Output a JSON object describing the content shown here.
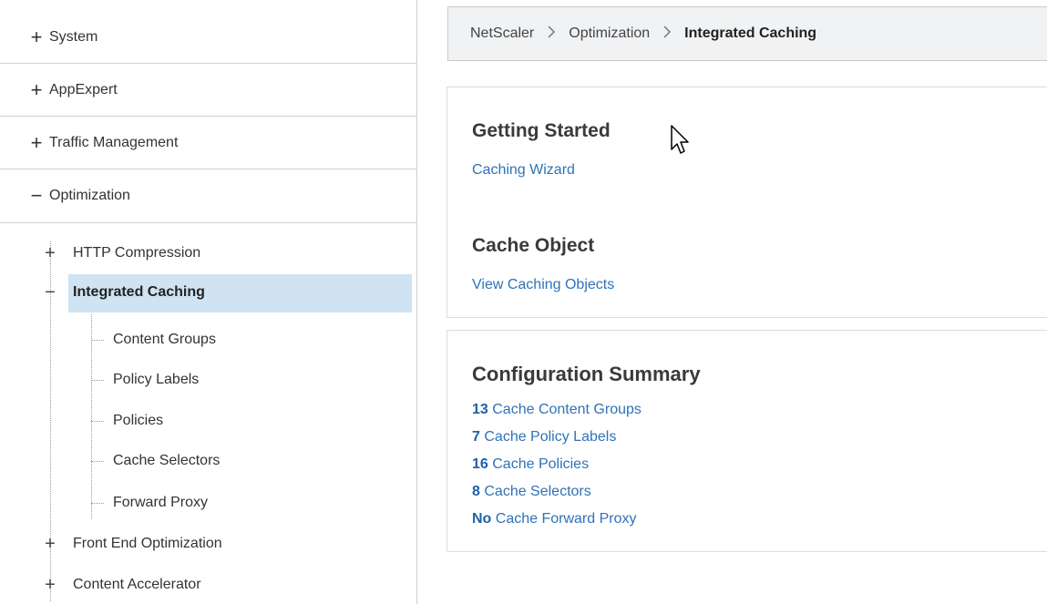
{
  "sidebar": {
    "top_items": [
      {
        "symbol": "+",
        "label": "System"
      },
      {
        "symbol": "+",
        "label": "AppExpert"
      },
      {
        "symbol": "+",
        "label": "Traffic Management"
      },
      {
        "symbol": "−",
        "label": "Optimization"
      }
    ],
    "sub_items": [
      {
        "symbol": "+",
        "label": "HTTP Compression"
      },
      {
        "symbol": "−",
        "label": "Integrated Caching"
      },
      {
        "symbol": "+",
        "label": "Front End Optimization"
      },
      {
        "symbol": "+",
        "label": "Content Accelerator"
      }
    ],
    "leaves": [
      "Content Groups",
      "Policy Labels",
      "Policies",
      "Cache Selectors",
      "Forward Proxy"
    ]
  },
  "breadcrumb": {
    "items": [
      "NetScaler",
      "Optimization",
      "Integrated Caching"
    ],
    "separator": ">"
  },
  "getting_started": {
    "title": "Getting Started",
    "link": "Caching Wizard"
  },
  "cache_object": {
    "title": "Cache Object",
    "link": "View Caching Objects"
  },
  "configuration_summary": {
    "title": "Configuration Summary",
    "rows": [
      {
        "count": "13",
        "label": "Cache Content Groups"
      },
      {
        "count": "7",
        "label": "Cache Policy Labels"
      },
      {
        "count": "16",
        "label": "Cache Policies"
      },
      {
        "count": "8",
        "label": "Cache Selectors"
      },
      {
        "count": "No",
        "label": "Cache Forward Proxy"
      }
    ]
  },
  "colors": {
    "link": "#2f72b7",
    "selected_bg": "#cfe3f2",
    "breadcrumb_bg": "#f1f2f4"
  }
}
